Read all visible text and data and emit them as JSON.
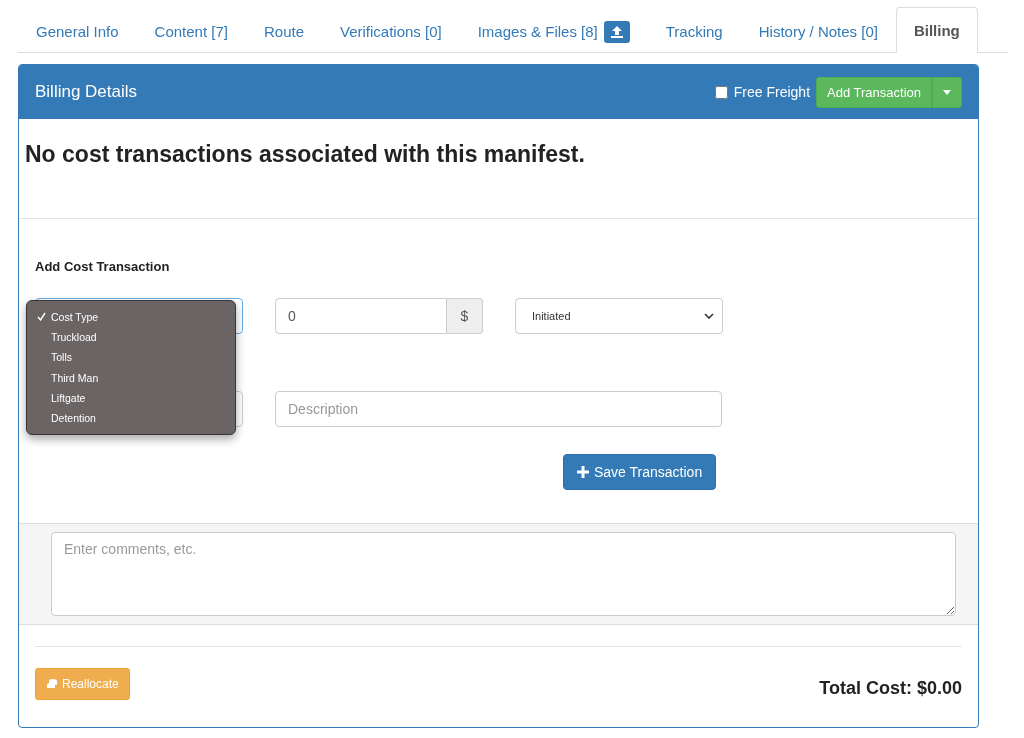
{
  "tabs": [
    {
      "label": "General Info",
      "selected": false,
      "upload": false
    },
    {
      "label": "Content [7]",
      "selected": false,
      "upload": false
    },
    {
      "label": "Route",
      "selected": false,
      "upload": false
    },
    {
      "label": "Verifications [0]",
      "selected": false,
      "upload": false
    },
    {
      "label": "Images & Files [8]",
      "selected": false,
      "upload": true
    },
    {
      "label": "Tracking",
      "selected": false,
      "upload": false
    },
    {
      "label": "History / Notes [0]",
      "selected": false,
      "upload": false
    },
    {
      "label": "Billing",
      "selected": true,
      "upload": false
    }
  ],
  "panel": {
    "title": "Billing Details",
    "free_freight": {
      "label": "Free Freight",
      "checked": false
    },
    "add_button": "Add Transaction"
  },
  "message": "No cost transactions associated with this manifest.",
  "form": {
    "title": "Add Cost Transaction",
    "cost_type_menu": [
      {
        "label": "Cost Type",
        "selected": true
      },
      {
        "label": "Truckload",
        "selected": false
      },
      {
        "label": "Tolls",
        "selected": false
      },
      {
        "label": "Third Man",
        "selected": false
      },
      {
        "label": "Liftgate",
        "selected": false
      },
      {
        "label": "Detention",
        "selected": false
      }
    ],
    "amount": "0",
    "currency": "$",
    "status": "Initiated",
    "description_placeholder": "Description",
    "save_button": "Save Transaction"
  },
  "comments_placeholder": "Enter comments, etc.",
  "reallocate_button": "Reallocate",
  "total": "Total Cost: $0.00"
}
